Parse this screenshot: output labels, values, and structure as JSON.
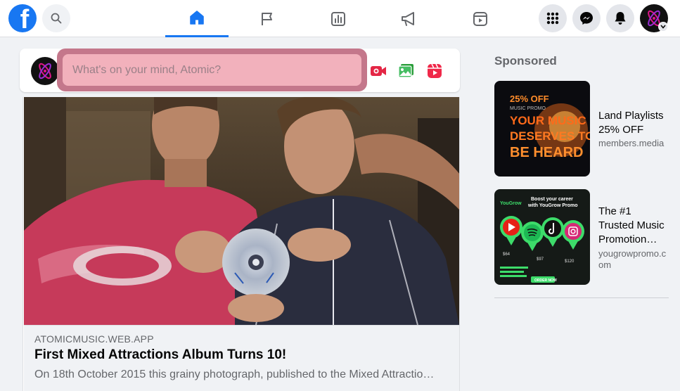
{
  "topbar": {
    "logo_letter": "f",
    "nav": [
      "home-icon",
      "flag-icon",
      "chart-icon",
      "megaphone-icon",
      "reels-icon"
    ],
    "accent": "#1877f2"
  },
  "composer": {
    "placeholder": "What's on your mind, Atomic?"
  },
  "post": {
    "domain": "ATOMICMUSIC.WEB.APP",
    "title": "First Mixed Attractions Album Turns 10!",
    "description": "On 18th October 2015 this grainy photograph, published to the Mixed Attractio…"
  },
  "sponsored": {
    "heading": "Sponsored",
    "ads": [
      {
        "title": "Land Playlists 25% OFF",
        "domain": "members.media",
        "image_lines": [
          "25% OFF",
          "MUSIC PROMO",
          "YOUR MUSIC",
          "DESERVES TO",
          "BE HEARD"
        ]
      },
      {
        "title": "The #1 Trusted Music Promotion…",
        "domain": "yougrowpromo.com",
        "image_lines": [
          "Boost your career",
          "with YouGrow Promo",
          "YouGrow",
          "$64",
          "$97",
          "$120",
          "ORDER NOW"
        ]
      }
    ]
  }
}
